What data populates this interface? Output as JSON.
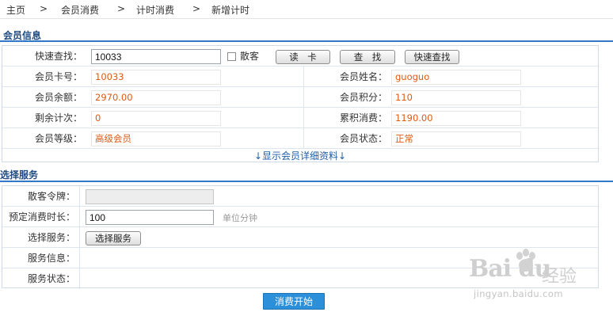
{
  "breadcrumb": {
    "items": [
      "主页",
      "会员消费",
      "计时消费",
      "新增计时"
    ],
    "separator": ">"
  },
  "member_section": {
    "title": "会员信息",
    "quick_search_label": "快速查找：",
    "quick_search_value": "10033",
    "walkin_label": "散客",
    "read_card_button": "读　卡",
    "search_button": "查　找",
    "quick_search_button": "快速查找",
    "card_no_label": "会员卡号：",
    "card_no_value": "10033",
    "name_label": "会员姓名：",
    "name_value": "guoguo",
    "balance_label": "会员余额：",
    "balance_value": "2970.00",
    "points_label": "会员积分：",
    "points_value": "110",
    "remaining_count_label": "剩余计次：",
    "remaining_count_value": "0",
    "total_spend_label": "累积消费：",
    "total_spend_value": "1190.00",
    "level_label": "会员等级：",
    "level_value": "高级会员",
    "status_label": "会员状态：",
    "status_value": "正常",
    "show_details_link": "↓显示会员详细资料↓"
  },
  "service_section": {
    "title": "选择服务",
    "walkin_token_label": "散客令牌：",
    "walkin_token_value": "",
    "duration_label": "预定消费时长：",
    "duration_value": "100",
    "duration_hint": "单位分钟",
    "select_service_label": "选择服务：",
    "select_service_button": "选择服务",
    "service_info_label": "服务信息：",
    "service_info_value": "",
    "service_status_label": "服务状态：",
    "service_status_value": ""
  },
  "start_button": "消费开始",
  "watermark": {
    "logo": "Bai du",
    "jingyan": "经验",
    "url": "jingyan.baidu.com"
  },
  "colors": {
    "accent": "#2f79c8",
    "value_text": "#e05a12",
    "primary_button": "#2b8fd9",
    "section_title": "#1e4a80"
  }
}
